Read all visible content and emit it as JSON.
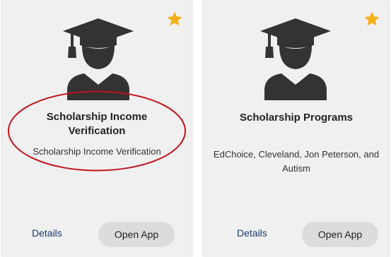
{
  "cards": [
    {
      "title": "Scholarship Income Verification",
      "description": "Scholarship Income Verification",
      "details_label": "Details",
      "open_label": "Open App",
      "favorite": true,
      "icon": "graduate-icon"
    },
    {
      "title": "Scholarship Programs",
      "description": "EdChoice, Cleveland, Jon Peterson, and Autism",
      "details_label": "Details",
      "open_label": "Open App",
      "favorite": true,
      "icon": "graduate-icon"
    }
  ],
  "colors": {
    "card_bg": "#f0f0f0",
    "icon": "#333333",
    "star": "#f5b11b",
    "highlight": "#c0141e",
    "link": "#1a3a6e",
    "button_bg": "#dcdcdc"
  }
}
